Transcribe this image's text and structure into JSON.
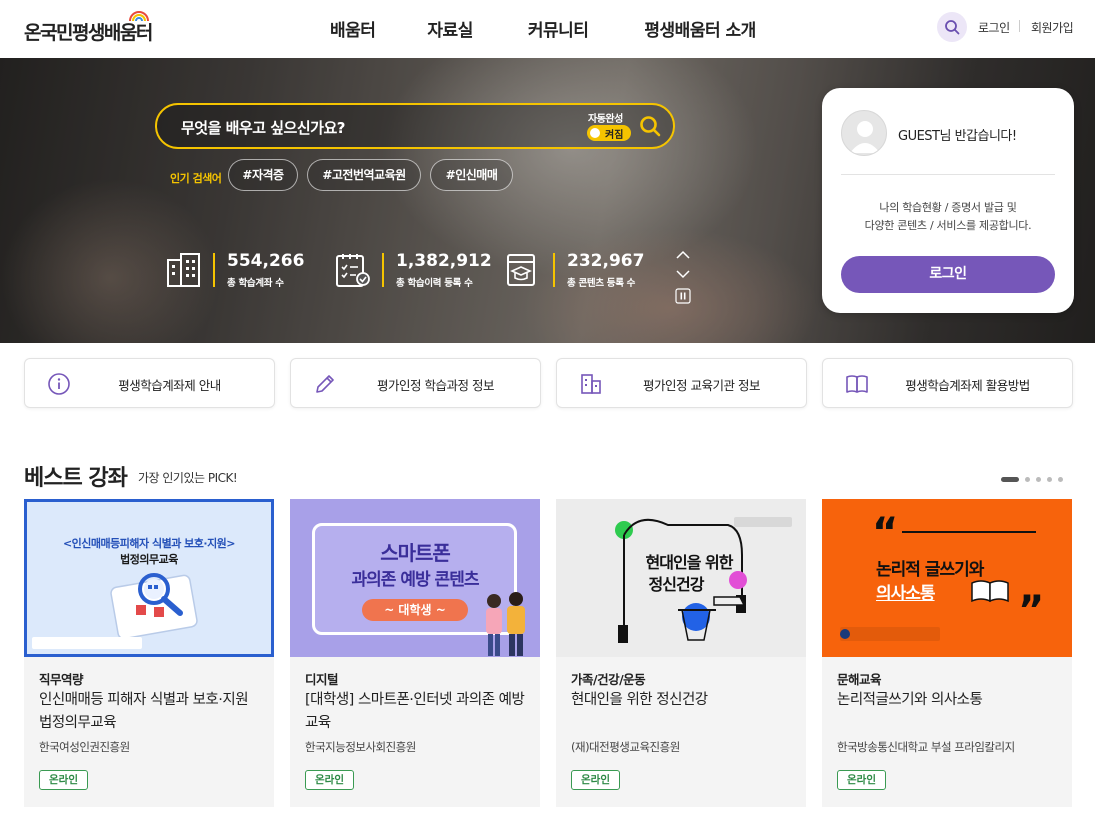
{
  "header": {
    "logo": "온국민평생배움터",
    "nav": [
      "배움터",
      "자료실",
      "커뮤니티",
      "평생배움터 소개"
    ],
    "login": "로그인",
    "signup": "회원가입"
  },
  "hero": {
    "search_placeholder": "무엇을 배우고 싶으신가요?",
    "autocomplete_label": "자동완성",
    "autocomplete_state": "켜짐",
    "popular_label": "인기 검색어",
    "tags": [
      "#자격증",
      "#고전번역교육원",
      "#인신매매"
    ],
    "stats": [
      {
        "number": "554,266",
        "label": "총 학습계좌 수",
        "icon": "building-icon"
      },
      {
        "number": "1,382,912",
        "label": "총 학습이력 등록 수",
        "icon": "checklist-icon"
      },
      {
        "number": "232,967",
        "label": "총 콘텐츠 등록 수",
        "icon": "content-icon"
      }
    ]
  },
  "login_card": {
    "greeting": "GUEST님 반갑습니다!",
    "desc_line1": "나의 학습현황 / 증명서 발급 및",
    "desc_line2": "다양한 콘텐츠 / 서비스를 제공합니다.",
    "button": "로그인"
  },
  "quick_links": [
    {
      "label": "평생학습계좌제 안내",
      "icon": "info-icon"
    },
    {
      "label": "평가인정 학습과정 정보",
      "icon": "pencil-icon"
    },
    {
      "label": "평가인정 교육기관 정보",
      "icon": "building-icon"
    },
    {
      "label": "평생학습계좌제 활용방법",
      "icon": "book-icon"
    }
  ],
  "best": {
    "title": "베스트 강좌",
    "subtitle": "가장 인기있는 PICK!",
    "cards": [
      {
        "category": "직무역량",
        "title": "인신매매등 피해자 식별과 보호·지원 법정의무교육",
        "org": "한국여성인권진흥원",
        "badge": "온라인",
        "thumb_line1": "<인신매매등피해자 식별과 보호·지원>",
        "thumb_line2": "법정의무교육"
      },
      {
        "category": "디지털",
        "title": "[대학생] 스마트폰·인터넷 과의존 예방 교육",
        "org": "한국지능정보사회진흥원",
        "badge": "온라인",
        "thumb_line1": "스마트폰",
        "thumb_line2": "과의존 예방 콘텐츠",
        "thumb_line3": "~ 대학생 ~"
      },
      {
        "category": "가족/건강/운동",
        "title": "현대인을 위한 정신건강",
        "org": "(재)대전평생교육진흥원",
        "badge": "온라인",
        "thumb_line1": "현대인을 위한",
        "thumb_line2": "정신건강"
      },
      {
        "category": "문해교육",
        "title": "논리적글쓰기와 의사소통",
        "org": "한국방송통신대학교 부설 프라임칼리지",
        "badge": "온라인",
        "thumb_line1": "논리적 글쓰기와",
        "thumb_line2": "의사소통"
      }
    ]
  },
  "colors": {
    "accent": "#7657b9",
    "yellow": "#f5c400",
    "badge": "#2e8a46"
  }
}
